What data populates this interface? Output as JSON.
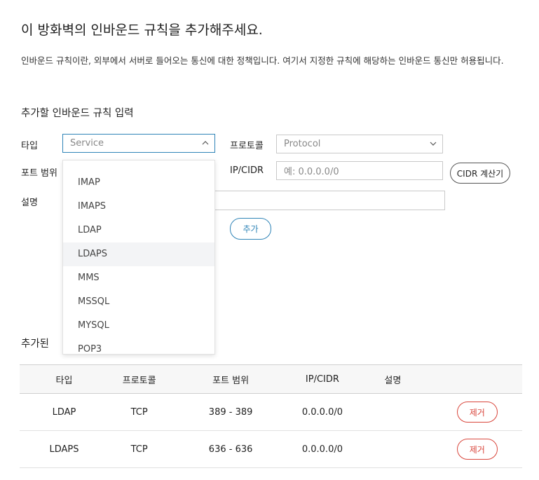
{
  "header": {
    "title": "이 방화벽의 인바운드 규칙을 추가해주세요.",
    "description": "인바운드 규칙이란, 외부에서 서버로 들어오는 통신에 대한 정책입니다. 여기서 지정한 규칙에 해당하는 인바운드 통신만 허용됩니다."
  },
  "form": {
    "section_title": "추가할 인바운드 규칙 입력",
    "type_label": "타입",
    "type_placeholder": "Service",
    "protocol_label": "프로토콜",
    "protocol_placeholder": "Protocol",
    "port_label": "포트 범위",
    "ip_label": "IP/CIDR",
    "ip_placeholder": "예: 0.0.0.0/0",
    "cidr_button": "CIDR 계산기",
    "desc_label": "설명",
    "add_button": "추가",
    "type_options": [
      "IMAP",
      "IMAPS",
      "LDAP",
      "LDAPS",
      "MMS",
      "MSSQL",
      "MYSQL",
      "POP3"
    ],
    "highlighted_option": "LDAPS"
  },
  "added": {
    "section_title_partial": "추가된 ",
    "columns": [
      "타입",
      "프로토콜",
      "포트 범위",
      "IP/CIDR",
      "설명",
      ""
    ],
    "rows": [
      {
        "type": "LDAP",
        "protocol": "TCP",
        "port": "389 - 389",
        "cidr": "0.0.0.0/0",
        "desc": "",
        "remove": "제거"
      },
      {
        "type": "LDAPS",
        "protocol": "TCP",
        "port": "636 - 636",
        "cidr": "0.0.0.0/0",
        "desc": "",
        "remove": "제거"
      }
    ]
  },
  "colors": {
    "accent": "#2f84b7",
    "danger": "#d9463c",
    "highlight_bg": "#f3f4f6",
    "table_header_bg": "#f7f7f7"
  }
}
